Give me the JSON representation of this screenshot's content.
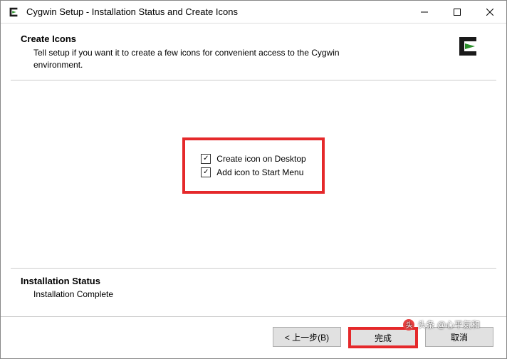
{
  "titlebar": {
    "title": "Cygwin Setup - Installation Status and Create Icons"
  },
  "header": {
    "title": "Create Icons",
    "description": "Tell setup if you want it to create a few icons for convenient access to the Cygwin environment."
  },
  "checkboxes": {
    "desktop": {
      "label": "Create icon on Desktop",
      "checked": true
    },
    "startmenu": {
      "label": "Add icon to Start Menu",
      "checked": true
    }
  },
  "status": {
    "title": "Installation Status",
    "text": "Installation Complete"
  },
  "footer": {
    "back": "< 上一步(B)",
    "finish": "完成",
    "cancel": "取消"
  },
  "watermark": "头条 @心平氣和"
}
